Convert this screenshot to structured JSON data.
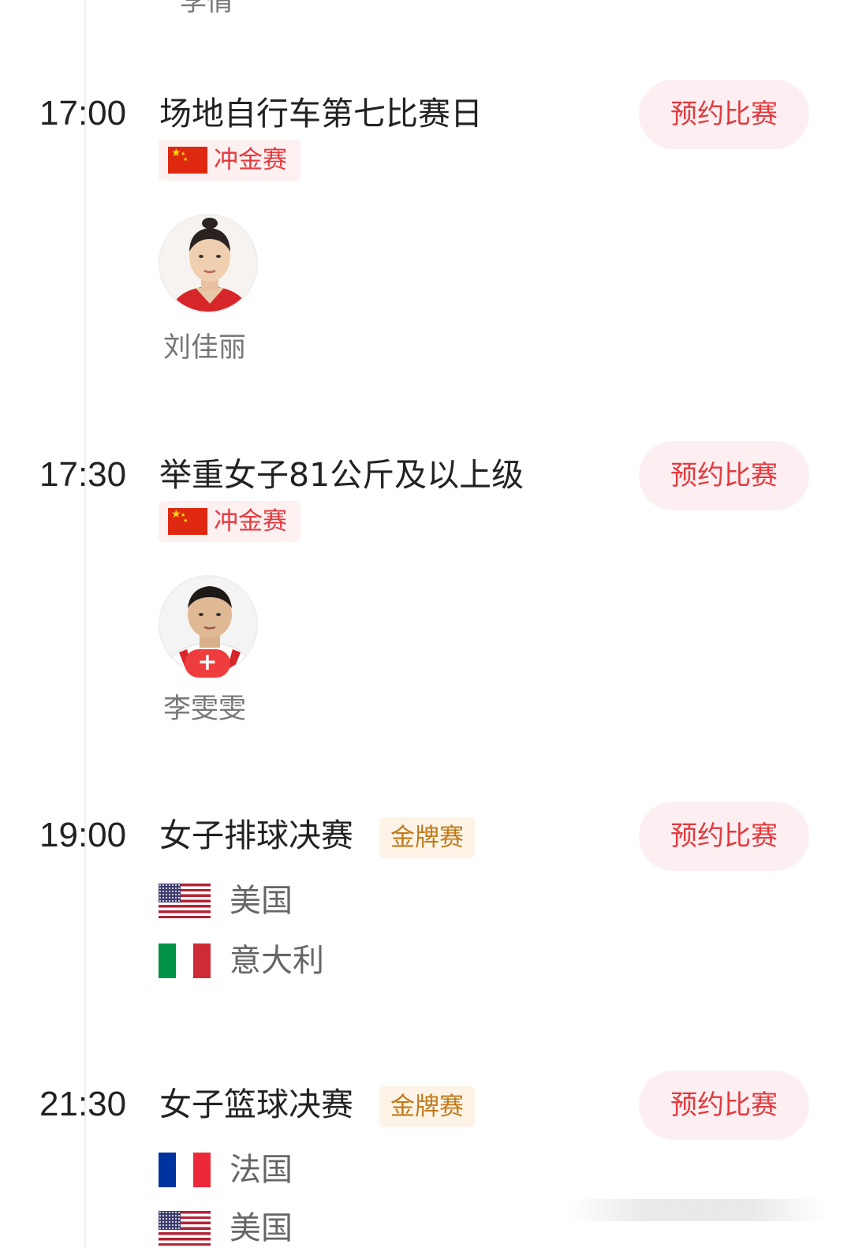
{
  "top_partial": {
    "name": "李倩"
  },
  "events": [
    {
      "time": "17:00",
      "title": "场地自行车第七比赛日",
      "button_label": "预约比赛",
      "tag": "冲金赛",
      "athlete": {
        "name": "刘佳丽",
        "plus_badge": ""
      }
    },
    {
      "time": "17:30",
      "title": "举重女子81公斤及以上级",
      "button_label": "预约比赛",
      "tag": "冲金赛",
      "athlete": {
        "name": "李雯雯",
        "plus_badge": "+"
      }
    },
    {
      "time": "19:00",
      "title": "女子排球决赛",
      "button_label": "预约比赛",
      "tag": "金牌赛",
      "teams": [
        {
          "name": "美国",
          "flag": "us-flag"
        },
        {
          "name": "意大利",
          "flag": "italy-flag"
        }
      ]
    },
    {
      "time": "21:30",
      "title": "女子篮球决赛",
      "button_label": "预约比赛",
      "tag": "金牌赛",
      "teams": [
        {
          "name": "法国",
          "flag": "france-flag"
        },
        {
          "name": "美国",
          "flag": "us-flag"
        }
      ]
    }
  ],
  "colors": {
    "accent_red": "#e23a3f",
    "button_bg": "#fdeff1",
    "gold_text": "#c17a1a",
    "gold_bg": "#fdf3e6"
  }
}
